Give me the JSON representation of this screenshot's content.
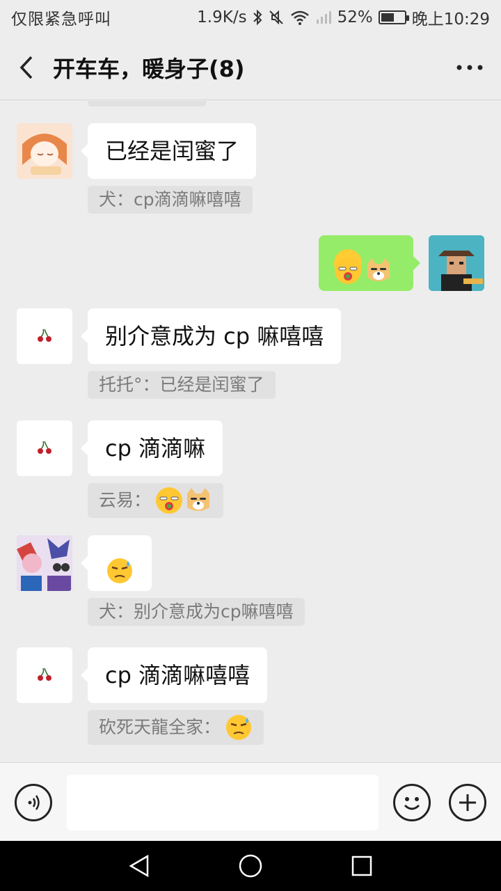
{
  "status_bar": {
    "carrier": "仅限紧急呼叫",
    "net_speed": "1.9K/s",
    "battery_percent": "52%",
    "time": "晚上10:29",
    "icons": [
      "bluetooth-icon",
      "mute-icon",
      "wifi-icon",
      "signal-icon",
      "battery-icon"
    ]
  },
  "header": {
    "title": "开车车，暖身子(8)"
  },
  "messages": [
    {
      "side": "left",
      "avatar": "anime-girl-avatar",
      "text": "已经是闰蜜了",
      "quote": "犬：cp滴滴嘛嘻嘻"
    },
    {
      "side": "right",
      "avatar": "self-avatar",
      "emoji": [
        "blushing-smile-emoji",
        "doge-emoji"
      ]
    },
    {
      "side": "left",
      "avatar": "cherry-avatar",
      "text": "别介意成为 cp 嘛嘻嘻",
      "quote": "托托°：已经是闰蜜了"
    },
    {
      "side": "left",
      "avatar": "cherry-avatar",
      "text": "cp 滴滴嘛",
      "quote": "云易：",
      "quote_emoji": [
        "blushing-smile-emoji",
        "doge-emoji"
      ]
    },
    {
      "side": "left",
      "avatar": "game-characters-avatar",
      "emoji": [
        "sweat-smirk-emoji"
      ],
      "quote": "犬：别介意成为cp嘛嘻嘻"
    },
    {
      "side": "left",
      "avatar": "cherry-avatar",
      "text": "cp 滴滴嘛嘻嘻",
      "quote": "砍死天龍全家：",
      "quote_emoji": [
        "sweat-smirk-emoji"
      ]
    }
  ],
  "input": {
    "value": "",
    "placeholder": ""
  },
  "nav": [
    "back-triangle-icon",
    "home-circle-icon",
    "recents-square-icon"
  ],
  "colors": {
    "background": "#ededed",
    "bubble_self": "#95ec69",
    "bubble_other": "#ffffff",
    "quote_bg": "#e1e1e1"
  }
}
